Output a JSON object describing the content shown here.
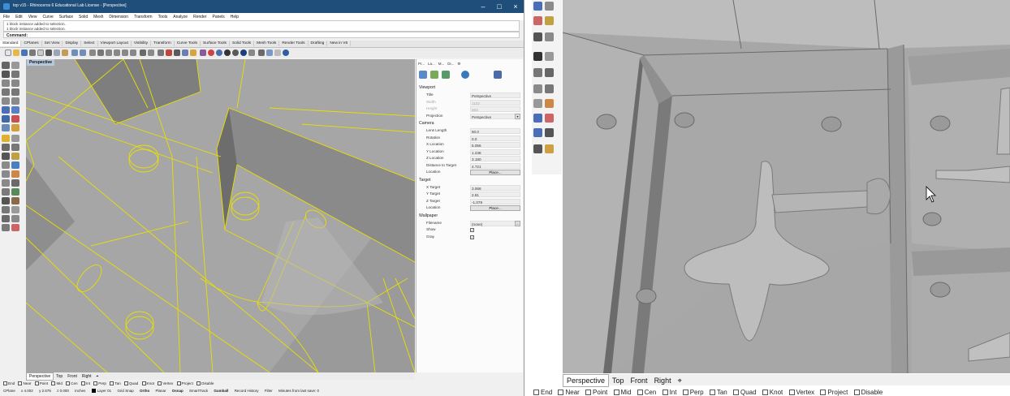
{
  "window": {
    "title": "top v15 - Rhinoceros 6 Educational Lab License - [Perspective]",
    "controls": [
      "–",
      "□",
      "×"
    ]
  },
  "menu": [
    "File",
    "Edit",
    "View",
    "Curve",
    "Surface",
    "Solid",
    "Mesh",
    "Dimension",
    "Transform",
    "Tools",
    "Analyze",
    "Render",
    "Panels",
    "Help"
  ],
  "command_history": [
    "1 block instance added to selection.",
    "1 block instance added to selection."
  ],
  "command_prompt": "Command:",
  "toolbar_tabs": [
    "Standard",
    "CPlanes",
    "Set View",
    "Display",
    "Select",
    "Viewport Layout",
    "Visibility",
    "Transform",
    "Curve Tools",
    "Surface Tools",
    "Solid Tools",
    "Mesh Tools",
    "Render Tools",
    "Drafting",
    "New in V6"
  ],
  "active_toolbar_tab": "Standard",
  "viewport": {
    "label": "Perspective",
    "tabs": [
      "Perspective",
      "Top",
      "Front",
      "Right",
      "⌖"
    ]
  },
  "panel": {
    "tabs": [
      "Pr...",
      "La...",
      "M...",
      "Di...",
      "⚙"
    ],
    "viewport_section": "Viewport",
    "title_label": "Title",
    "title_value": "Perspective",
    "width_label": "Width",
    "width_value": "1102",
    "height_label": "Height",
    "height_value": "563",
    "projection_label": "Projection",
    "projection_value": "Perspective",
    "camera_section": "Camera",
    "lens_label": "Lens Length",
    "lens_value": "50.0",
    "rotation_label": "Rotation",
    "rotation_value": "0.0",
    "xloc_label": "X Location",
    "xloc_value": "5.056",
    "yloc_label": "Y Location",
    "yloc_value": "1.238",
    "zloc_label": "Z Location",
    "zloc_value": "3.180",
    "dist_label": "Distance to Target",
    "dist_value": "4.721",
    "cam_location_label": "Location",
    "place_button": "Place...",
    "target_section": "Target",
    "xtarget_label": "X Target",
    "xtarget_value": "3.068",
    "ytarget_label": "Y Target",
    "ytarget_value": "2.81",
    "ztarget_label": "Z Target",
    "ztarget_value": "-1.078",
    "tgt_location_label": "Location",
    "wallpaper_section": "Wallpaper",
    "filename_label": "Filename",
    "filename_value": "(none)",
    "show_label": "Show",
    "gray_label": "Gray"
  },
  "osnap_left": [
    "End",
    "Near",
    "Point",
    "Mid",
    "Cen",
    "Int",
    "Perp",
    "Tan",
    "Quad",
    "Knot",
    "Vertex",
    "Project",
    "Disable"
  ],
  "status_left": {
    "cplane": "CPlane",
    "x": "x 4.002",
    "y": "y 2.675",
    "z": "z 0.000",
    "units": "Inches",
    "layer": "Layer 01",
    "grid_snap": "Grid Snap",
    "ortho": "Ortho",
    "planar": "Planar",
    "osnap": "Osnap",
    "smarttrack": "SmartTrack",
    "gumball": "Gumball",
    "record_history": "Record History",
    "filter": "Filter",
    "minutes": "Minutes from last save: 0"
  },
  "right_viewport_tabs": [
    "Perspective",
    "Top",
    "Front",
    "Right",
    "⌖"
  ],
  "osnap_right": [
    "End",
    "Near",
    "Point",
    "Mid",
    "Cen",
    "Int",
    "Perp",
    "Tan",
    "Quad",
    "Knot",
    "Vertex",
    "Project",
    "Disable"
  ],
  "colors": {
    "titlebar": "#1f4e7a",
    "selection_wireframe": "#e8e000",
    "viewport_bg": "#9b9b9b",
    "model_gray": "#b4b4b4"
  }
}
